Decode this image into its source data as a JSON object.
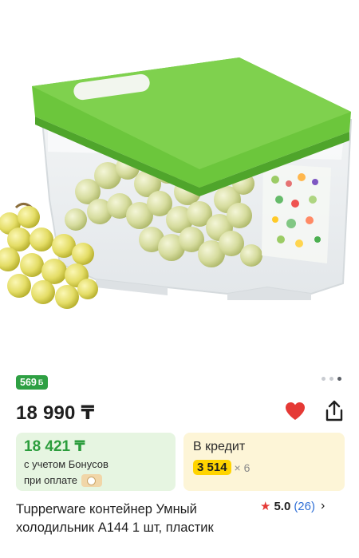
{
  "gallery": {
    "page_count": 3,
    "active_index": 2
  },
  "bonus_badge": {
    "value": "569",
    "icon": "Б"
  },
  "price": {
    "value": "18 990 ₸"
  },
  "actions": {
    "favorite_icon": "heart-icon",
    "share_icon": "share-icon",
    "favorite_color": "#e53935"
  },
  "bonus_card": {
    "amount": "18 421 ₸",
    "line1": "с учетом Бонусов",
    "line2": "при оплате"
  },
  "credit_card": {
    "title": "В кредит",
    "monthly": "3 514",
    "multiplier": "× 6"
  },
  "product": {
    "title": "Tupperware контейнер Умный холодильник А144 1 шт, пластик"
  },
  "rating": {
    "score": "5.0",
    "count": "(26)"
  },
  "colors": {
    "lid_green": "#6cc63c",
    "bonus_green": "#2ea043",
    "credit_yellow": "#ffd400",
    "link_blue": "#2f6fd6"
  }
}
